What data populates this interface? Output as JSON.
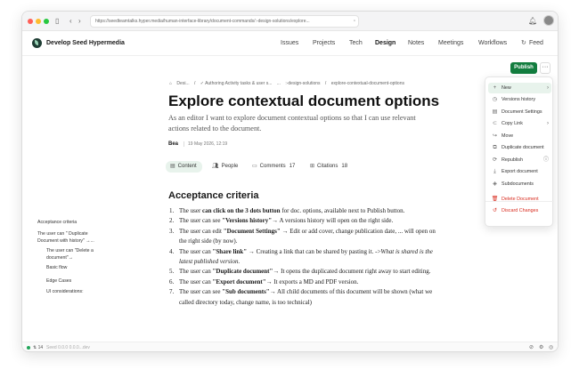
{
  "browser": {
    "url": "https://seedteamtalks.hyper.media/human-interface-library/document-commands/:-design-solutions/explore...",
    "back_icon": "chevron-left-icon",
    "forward_icon": "chevron-right-icon",
    "sidebar_icon": "sidebar-icon",
    "bookmark_icon": "bookmark-icon",
    "bell_icon": "bell-icon"
  },
  "header": {
    "site_title": "Develop Seed Hypermedia",
    "nav": [
      "Issues",
      "Projects",
      "Tech",
      "Design",
      "Notes",
      "Meetings",
      "Workflows"
    ],
    "active_nav": "Design",
    "feed_label": "Feed"
  },
  "toolbar": {
    "publish_label": "Publish",
    "more_label": "···"
  },
  "breadcrumb": [
    "Desi...",
    "/",
    "✓ Authoring Activity tasks & user s...",
    "...",
    ":-design-solutions",
    "/",
    "explore-contextual-document-options"
  ],
  "document": {
    "title": "Explore contextual document options",
    "summary": "As an editor I want to explore document contextual options so that I can use relevant actions related to the document.",
    "author": "Bea",
    "date": "19 May 2026, 12:19"
  },
  "tabs": [
    {
      "label": "Content",
      "count": "",
      "icon": "document-icon"
    },
    {
      "label": "People",
      "count": "",
      "icon": "people-icon"
    },
    {
      "label": "Comments",
      "count": "17",
      "icon": "comment-icon"
    },
    {
      "label": "Citations",
      "count": "18",
      "icon": "citation-icon"
    }
  ],
  "section_heading": "Acceptance criteria",
  "criteria": [
    {
      "num": "1.",
      "pre": "The user ",
      "bold": "can click on the 3 dots button",
      "post": " for doc. options, available next to Publish button.",
      "italic": ""
    },
    {
      "num": "2.",
      "pre": "The user can see ",
      "bold": "\"Versions history\"",
      "post": "→ A versions history will open on the right side.",
      "italic": ""
    },
    {
      "num": "3.",
      "pre": "The user can edit ",
      "bold": "\"Document Settings\"",
      "post": " → Edit or add cover, change publication date, ... will open on the right side (by now).",
      "italic": ""
    },
    {
      "num": "4.",
      "pre": "The user can ",
      "bold": "\"Share link\"",
      "post": " → Creating a link that can be shared by pasting it. ->",
      "italic": "What is shared is the latest published version."
    },
    {
      "num": "5.",
      "pre": "The user can ",
      "bold": "\"Duplicate document\"",
      "post": "→ It opens the duplicated document right away to start editing.",
      "italic": ""
    },
    {
      "num": "6.",
      "pre": "The user can ",
      "bold": "\"Export document\"",
      "post": "→ It exports a MD and PDF version.",
      "italic": ""
    },
    {
      "num": "7.",
      "pre": "The user can see ",
      "bold": "\"Sub documents\"",
      "post": "→ All child documents of this document will be shown (what we called directory today, change name, is too technical)",
      "italic": ""
    }
  ],
  "toc": [
    {
      "label": "Acceptance criteria",
      "level": 0
    },
    {
      "label": "The user can \" Duplicate",
      "level": 0
    },
    {
      "label": "Document with history\" →...",
      "level": 0
    },
    {
      "label": "The user can \"Delete a",
      "level": 1
    },
    {
      "label": "document\"→",
      "level": 1
    },
    {
      "label": "Basic flow",
      "level": 1
    },
    {
      "label": "Edge Cases",
      "level": 1
    },
    {
      "label": "UI considerations:",
      "level": 1
    }
  ],
  "menu": [
    {
      "label": "New",
      "icon": "plus-icon",
      "chevron": "›",
      "danger": false,
      "hover": true
    },
    {
      "label": "Versions history",
      "icon": "history-icon",
      "chevron": "",
      "danger": false,
      "hover": false
    },
    {
      "label": "Document Settings",
      "icon": "settings-doc-icon",
      "chevron": "",
      "danger": false,
      "hover": false
    },
    {
      "label": "Copy Link",
      "icon": "link-icon",
      "chevron": "›",
      "danger": false,
      "hover": false
    },
    {
      "label": "Move",
      "icon": "move-icon",
      "chevron": "",
      "danger": false,
      "hover": false
    },
    {
      "label": "Duplicate document",
      "icon": "duplicate-icon",
      "chevron": "",
      "danger": false,
      "hover": false
    },
    {
      "label": "Republish",
      "icon": "republish-icon",
      "chevron": "ⓘ",
      "danger": false,
      "hover": false
    },
    {
      "label": "Export document",
      "icon": "export-icon",
      "chevron": "",
      "danger": false,
      "hover": false
    },
    {
      "label": "Subdocuments",
      "icon": "layers-icon",
      "chevron": "",
      "danger": false,
      "hover": false
    },
    {
      "label": "Delete Document",
      "icon": "trash-icon",
      "chevron": "",
      "danger": true,
      "hover": false
    },
    {
      "label": "Discard Changes",
      "icon": "discard-icon",
      "chevron": "",
      "danger": true,
      "hover": false
    }
  ],
  "statusbar": {
    "peers": "14",
    "version": "Seed 0.0.0 0.0.0...dev"
  },
  "colors": {
    "accent": "#137d3f",
    "active_tab_bg": "#e8f3ec",
    "danger": "#d92d20"
  }
}
